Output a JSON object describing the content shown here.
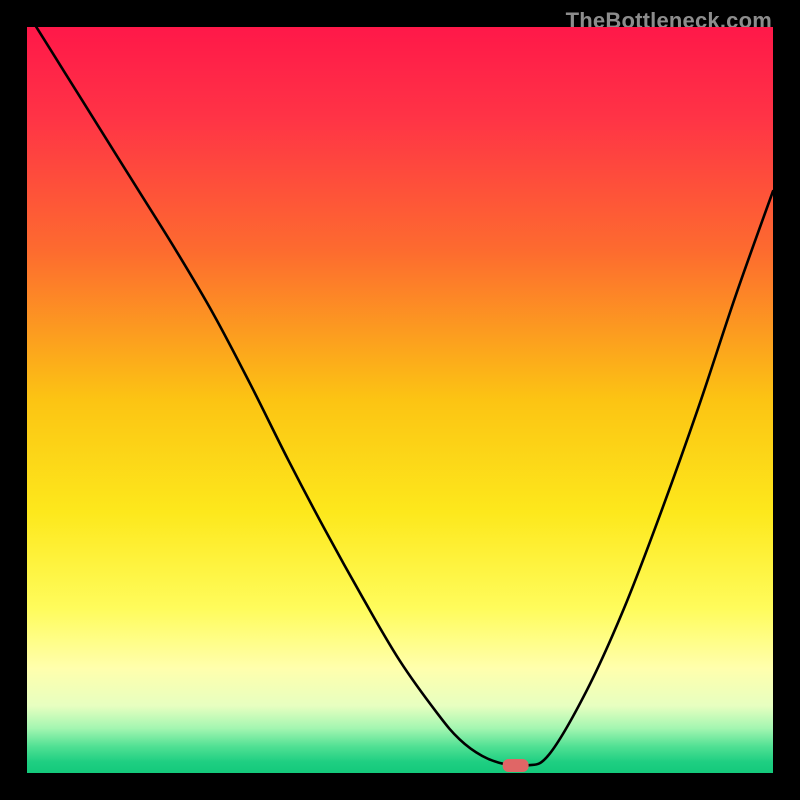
{
  "watermark": "TheBottleneck.com",
  "chart_data": {
    "type": "line",
    "title": "",
    "xlabel": "",
    "ylabel": "",
    "xlim": [
      0,
      100
    ],
    "ylim": [
      0,
      100
    ],
    "grid": false,
    "legend": false,
    "gradient_stops": [
      {
        "offset": 0.0,
        "color": "#ff1849"
      },
      {
        "offset": 0.12,
        "color": "#ff3346"
      },
      {
        "offset": 0.3,
        "color": "#fd6b2f"
      },
      {
        "offset": 0.5,
        "color": "#fcc413"
      },
      {
        "offset": 0.65,
        "color": "#fde81c"
      },
      {
        "offset": 0.78,
        "color": "#fffc5c"
      },
      {
        "offset": 0.86,
        "color": "#ffffad"
      },
      {
        "offset": 0.91,
        "color": "#e7ffc0"
      },
      {
        "offset": 0.94,
        "color": "#a4f6b1"
      },
      {
        "offset": 0.965,
        "color": "#4fe093"
      },
      {
        "offset": 0.985,
        "color": "#1fcf82"
      },
      {
        "offset": 1.0,
        "color": "#14c97b"
      }
    ],
    "curve": {
      "x": [
        0,
        5,
        10,
        15,
        20,
        25,
        30,
        35,
        40,
        45,
        50,
        55,
        58,
        61,
        64,
        67,
        70,
        75,
        80,
        85,
        90,
        95,
        100
      ],
      "y": [
        102,
        94,
        86,
        78,
        70,
        61.5,
        52,
        42,
        32.5,
        23.5,
        15,
        8,
        4.5,
        2.3,
        1.2,
        1.0,
        2.5,
        11,
        22,
        35,
        49,
        64,
        78
      ]
    },
    "marker": {
      "x": 65.5,
      "y": 1.0,
      "color": "#e06666"
    }
  }
}
